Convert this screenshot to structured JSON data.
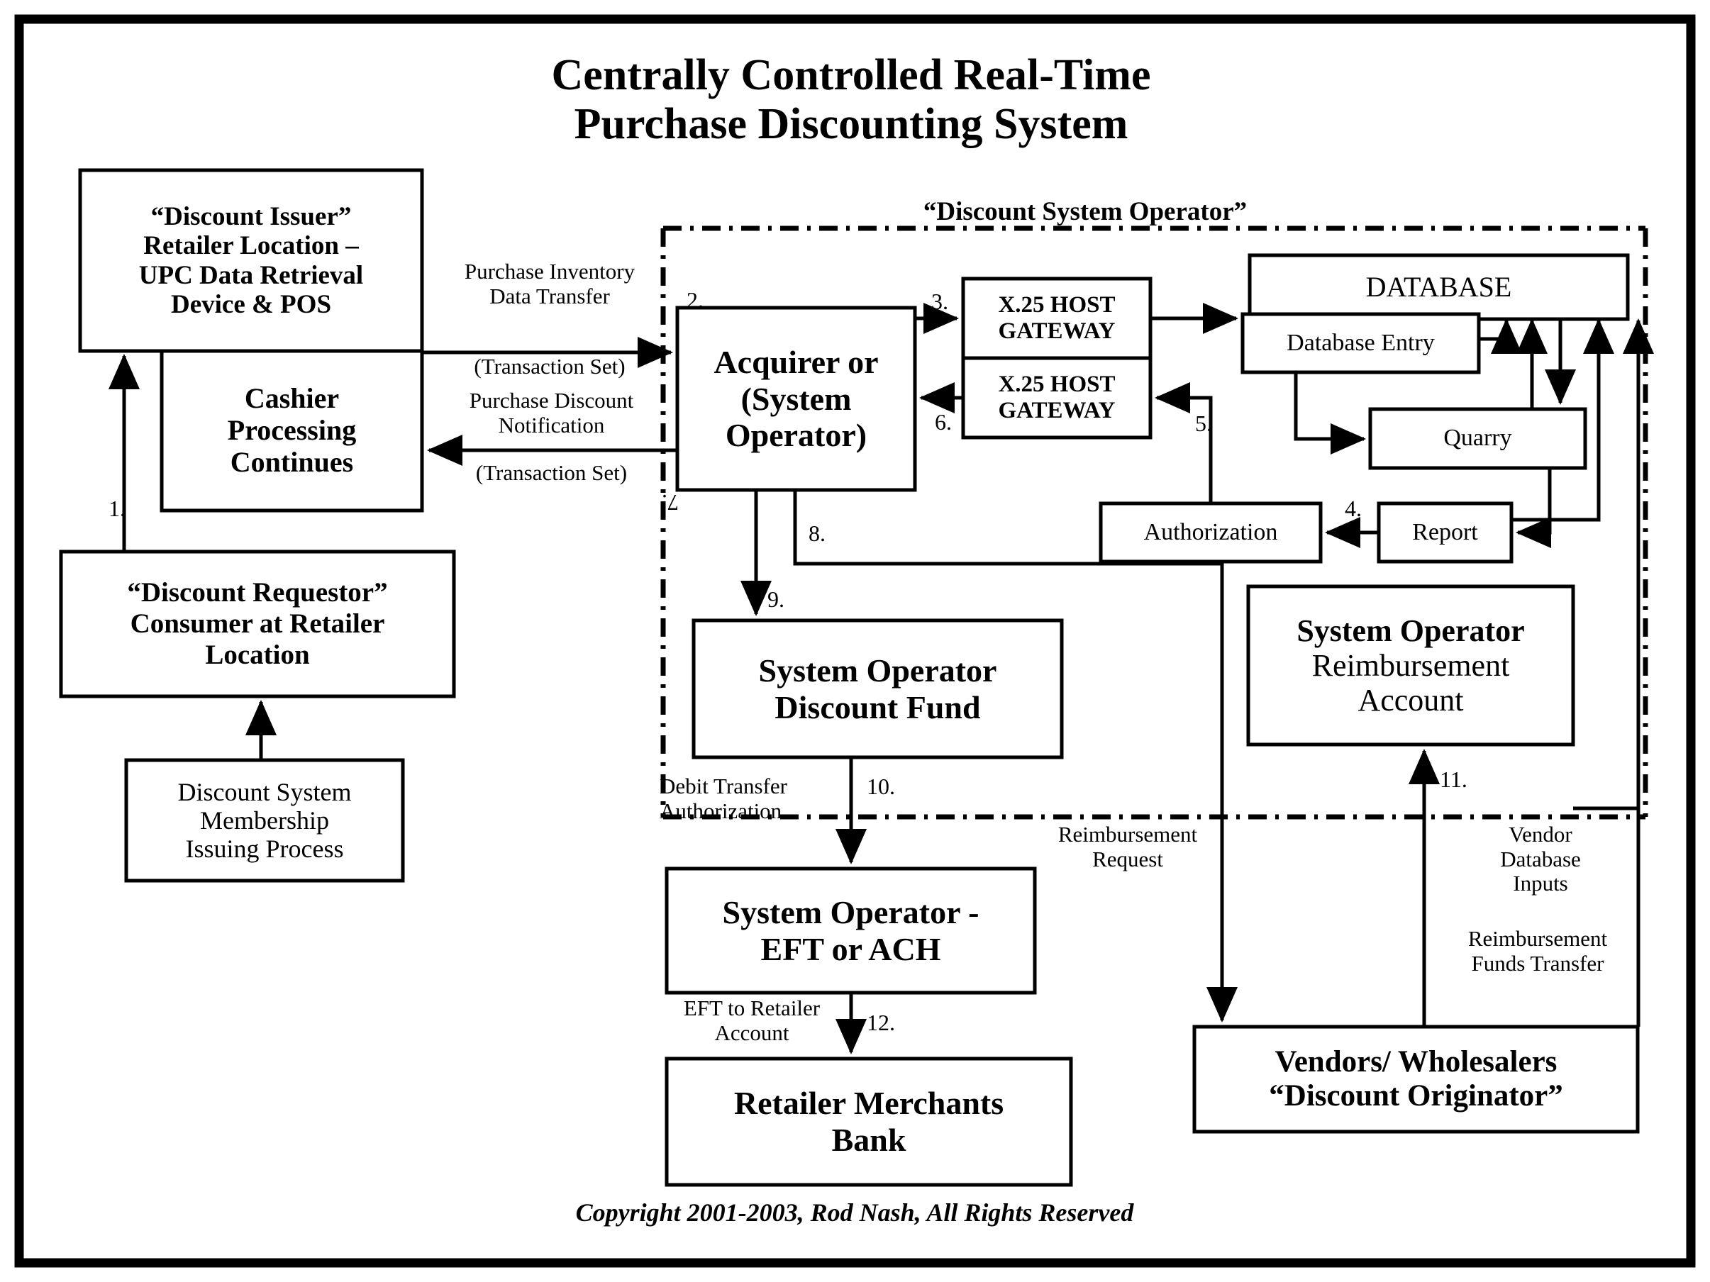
{
  "title": {
    "line1": "Centrally Controlled Real-Time",
    "line2": "Purchase Discounting System"
  },
  "zone": {
    "operator_label": "“Discount System Operator”"
  },
  "boxes": {
    "discount_issuer": {
      "line1": "“Discount Issuer”",
      "line2": "Retailer Location –",
      "line3": "UPC Data Retrieval",
      "line4": "Device & POS"
    },
    "cashier": {
      "line1": "Cashier",
      "line2": "Processing",
      "line3": "Continues"
    },
    "discount_requestor": {
      "line1": "“Discount Requestor”",
      "line2": "Consumer at Retailer",
      "line3": "Location"
    },
    "membership": {
      "line1": "Discount System",
      "line2": "Membership",
      "line3": "Issuing  Process"
    },
    "acquirer": {
      "line1": "Acquirer or",
      "line2": "(System",
      "line3": "Operator)"
    },
    "gateway_top": {
      "line1": "X.25 HOST",
      "line2": "GATEWAY"
    },
    "gateway_bottom": {
      "line1": "X.25 HOST",
      "line2": "GATEWAY"
    },
    "database": {
      "title": "DATABASE"
    },
    "database_entry": {
      "label": "Database Entry"
    },
    "quarry": {
      "label": "Quarry"
    },
    "report": {
      "label": "Report"
    },
    "authorization": {
      "label": "Authorization"
    },
    "reimbursement_account": {
      "line1": "System Operator",
      "line2": "Reimbursement",
      "line3": "Account"
    },
    "discount_fund": {
      "line1": "System Operator",
      "line2": "Discount Fund"
    },
    "eft_ach": {
      "line1": "System Operator -",
      "line2": "EFT or ACH"
    },
    "merchants_bank": {
      "line1": "Retailer Merchants",
      "line2": "Bank"
    },
    "vendors": {
      "line1": "Vendors/ Wholesalers",
      "line2": "“Discount Originator”"
    }
  },
  "edge_labels": {
    "purchase_inventory": {
      "line1": "Purchase Inventory",
      "line2": "Data Transfer",
      "line3": "(Transaction Set)"
    },
    "purchase_discount": {
      "line1": "Purchase Discount",
      "line2": "Notification",
      "line3": "(Transaction Set)"
    },
    "debit_transfer": {
      "line1": "Debit Transfer",
      "line2": "Authorization"
    },
    "eft_to_retailer": {
      "line1": "EFT to Retailer",
      "line2": "Account"
    },
    "reimbursement_request": {
      "line1": "Reimbursement",
      "line2": "Request"
    },
    "vendor_database_inputs": {
      "line1": "Vendor",
      "line2": "Database",
      "line3": "Inputs"
    },
    "reimbursement_funds": {
      "line1": "Reimbursement",
      "line2": "Funds Transfer"
    }
  },
  "step_numbers": {
    "s1": "1.",
    "s2": "2.",
    "s3": "3.",
    "s4": "4.",
    "s5": "5.",
    "s6": "6.",
    "s7": "7.",
    "s8": "8.",
    "s9": "9.",
    "s10": "10.",
    "s11": "11.",
    "s12": "12."
  },
  "footer": {
    "copyright": "Copyright 2001-2003, Rod Nash,  All Rights Reserved"
  },
  "colors": {
    "ink": "#000000",
    "paper": "#ffffff"
  }
}
